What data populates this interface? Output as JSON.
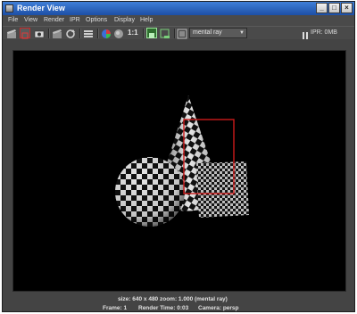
{
  "window": {
    "title": "Render View",
    "controls": {
      "minimize": "_",
      "maximize": "□",
      "close": "×"
    }
  },
  "menu": [
    "File",
    "View",
    "Render",
    "IPR",
    "Options",
    "Display",
    "Help"
  ],
  "toolbar": {
    "ratio_label": "1:1",
    "renderer": "mental ray",
    "ipr_status": "IPR: 0MB"
  },
  "status": {
    "line1": "size: 640 x 480  zoom: 1.000      (mental ray)",
    "frame": "Frame: 1",
    "render_time": "Render Time: 0:03",
    "camera": "Camera: persp"
  },
  "colors": {
    "titlebar": "#2a5fbf",
    "panel": "#444444",
    "viewport": "#000000",
    "region": "#cc1a1a"
  }
}
